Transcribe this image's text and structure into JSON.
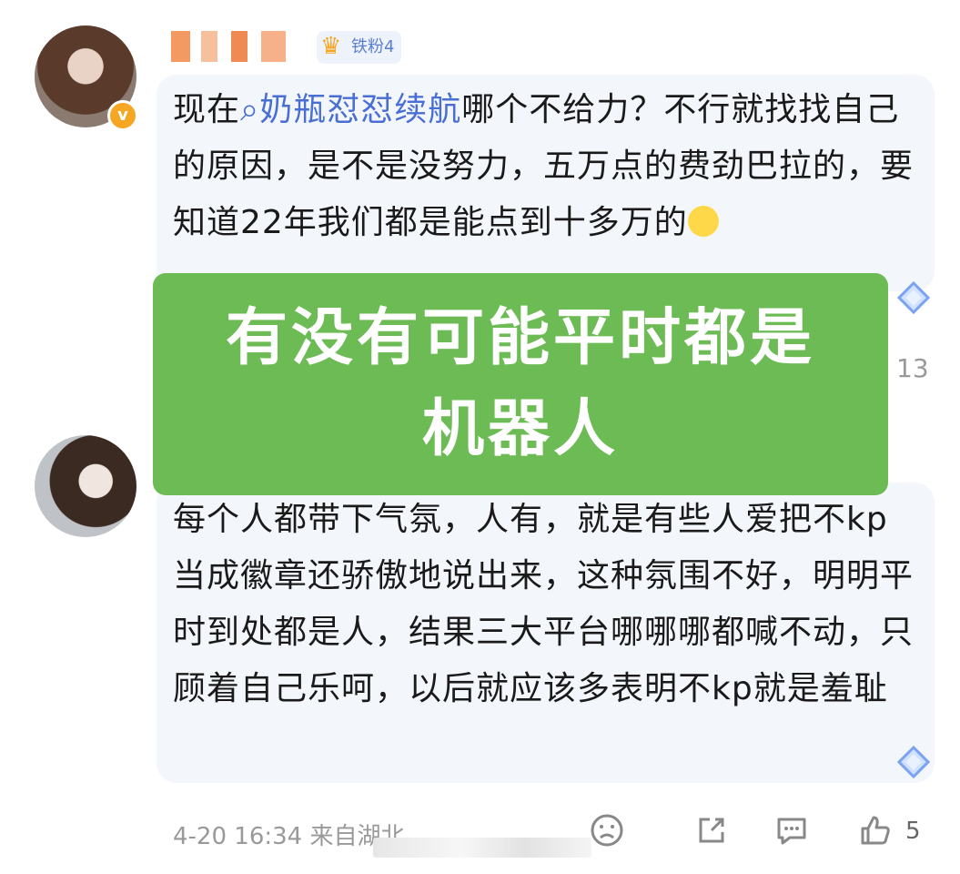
{
  "comment1": {
    "fan_badge": "铁粉4",
    "verified_mark": "v",
    "text_before": "现在",
    "topic": "奶瓶怼怼续航",
    "text_after": "哪个不给力？不行就找找自己的原因，是不是没努力，五万点的费劲巴拉的，要知道22年我们都是能点到十多万的",
    "count": "13"
  },
  "overlay": {
    "line1": "有没有可能平时都是",
    "line2": "机器人"
  },
  "comment2": {
    "text": "每个人都带下气氛，人有，就是有些人爱把不kp当成徽章还骄傲地说出来，这种氛围不好，明明平时到处都是人，结果三大平台哪哪哪都喊不动，只顾着自己乐呵，以后就应该多表明不kp就是羞耻"
  },
  "footer": {
    "time": "4-20 16:34 来自湖北",
    "like_count": "5"
  },
  "colors": {
    "overlay_green": "#6dbb55",
    "topic_blue": "#4a6fd4",
    "bubble_bg": "#f3f6fb"
  }
}
